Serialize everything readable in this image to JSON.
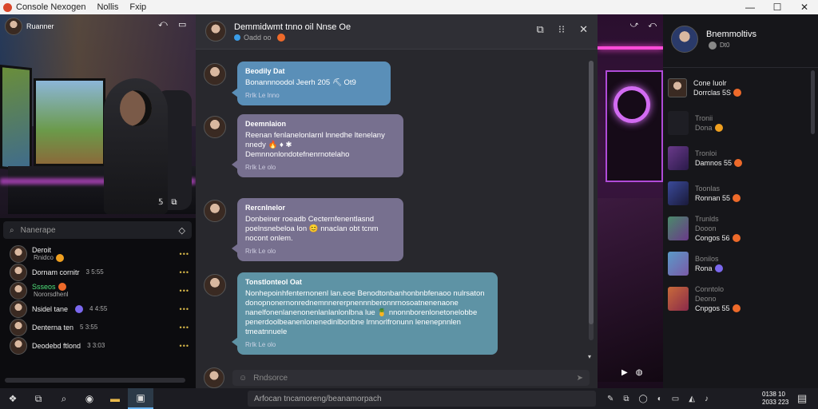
{
  "window": {
    "title": "Console Nexogen",
    "menu": [
      "Nollis",
      "Fxip"
    ],
    "controls": [
      "—",
      "☐",
      "✕"
    ]
  },
  "left_stream": {
    "streamer_name": "Ruanner",
    "ctl_a": "⤺",
    "ctl_b": "▭",
    "bottom_a": "𝟝",
    "bottom_b": "⧉"
  },
  "search": {
    "placeholder": "Nanerape"
  },
  "users": [
    {
      "name": "Deroit",
      "sub": "Rnidco",
      "badge": "yellow",
      "dots": "•••"
    },
    {
      "name": "Dornam cornitr",
      "sub": "3 5:55",
      "badge": "",
      "dots": "•••"
    },
    {
      "name": "Ssseos",
      "sub": "Nororsdhenl",
      "badge": "orange",
      "dots": "•••",
      "green": true
    },
    {
      "name": "Nsidel tane",
      "sub": "4 4:55",
      "badge": "purple",
      "dots": "•••"
    },
    {
      "name": "Denterna ten",
      "sub": "5 3:55",
      "badge": "",
      "dots": "•••"
    },
    {
      "name": "Deodebd ftlond",
      "sub": "3 3:03",
      "badge": "",
      "dots": "•••"
    }
  ],
  "chat": {
    "title": "Demmidwmt tnno oil Nnse Oe",
    "subtitle": "Oadd oo",
    "tools": [
      "⧉",
      "⁝⁝",
      "✕"
    ],
    "messages": [
      {
        "sender": "Beodily Dat",
        "text": "Bonannnoodol Jeerh 205 ⛏ Ot9",
        "time": "Rrlk Le lnno",
        "color": "blue"
      },
      {
        "sender": "Deemnlaion",
        "text": "Reenan fenlanelonlarnl lnnedhe ltenelany nnedy 🔥 ♦ ✱ Demnnonlondotefnenrnotelaho",
        "time": "Rrlk Le olo",
        "color": "purple"
      },
      {
        "sender": "Rercnlnelor",
        "text": "Donbeiner roeadb Cecternfenentlasnd poelnsnebeloa lon 😊 nnaclan obt tcnm nocont onlem.",
        "time": "Rrlk Le olo",
        "color": "purple"
      },
      {
        "sender": "Tonstlonteol Oat",
        "text": "Nonhepoinhfenternonenl lan.eoe Benodtonbanhonbnbfenaoo nulrsaton donopnonernonrednemnnererpnennnberonnrnosoatnenenaone nanelfonenlanenonenlanlanlonlbna lue 🍍 nnonnborenlonetonelobbe penerdoolbeanenlonenedinlbonbne lrnnorlfronunn lenenepnnlen tmeatnnuele",
        "time": "Rrlk Le olo",
        "color": "teal"
      }
    ],
    "composer_placeholder": "Rndsorce"
  },
  "right_stream": {
    "top_a": "⤻",
    "top_b": "⤺",
    "bot_a": "▶",
    "bot_b": "◍"
  },
  "host": {
    "name": "Bnemmoltivs",
    "status": "Dt0"
  },
  "right_items": [
    {
      "line1": "Cone Iuolr",
      "line2": "Dorrclas 5S",
      "badge": "orange",
      "thumb": "#d9b8a0",
      "muted": false
    },
    {
      "line1": "Tronii",
      "line2": "Dona",
      "badge": "yellow",
      "thumb": "",
      "muted": true
    },
    {
      "line1": "Tronloi",
      "line2": "Damnos 55",
      "badge": "orange",
      "thumb": "#6a3a8a",
      "muted": false
    },
    {
      "line1": "Toonlas",
      "line2": "Ronnan 55",
      "badge": "orange",
      "thumb": "#3a4a9a",
      "muted": false
    },
    {
      "line1": "Trunlds",
      "line2": "Dooon",
      "line3": "Congos 56",
      "badge": "orange",
      "thumb": "#4a8a6a",
      "muted": false
    },
    {
      "line1": "Bonilos",
      "line2": "Rona",
      "badge": "purple",
      "thumb": "#5a9ac8",
      "muted": false
    },
    {
      "line1": "Conntolo",
      "line2": "Deono",
      "line3": "Cnpgos 55",
      "badge": "orange",
      "thumb": "#c86a3a",
      "muted": false
    }
  ],
  "taskbar": {
    "search_placeholder": "Arfocan tncamoreng/beanamorpach",
    "time": "0138 10",
    "date": "2033 223"
  },
  "colors": {
    "accent": "#5a8fb8",
    "bubble_blue": "#5a8fb8",
    "bubble_purple": "#77708f",
    "bubble_teal": "#5e93a5",
    "online_green": "#4fe07a",
    "neon_pink": "#ff4bd8"
  }
}
